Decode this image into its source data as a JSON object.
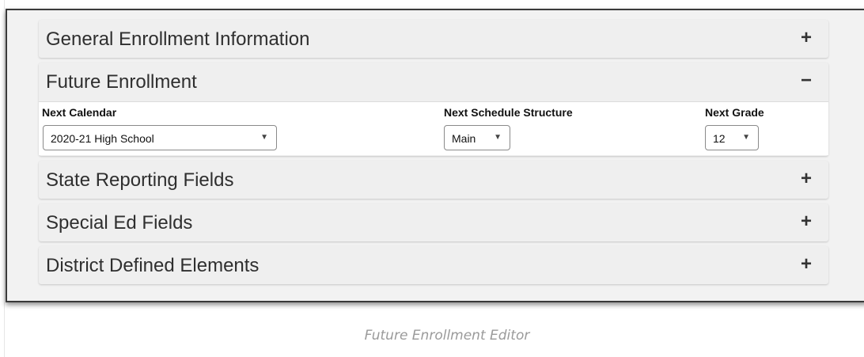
{
  "sections": {
    "general": {
      "title": "General Enrollment Information",
      "toggle": "+"
    },
    "future": {
      "title": "Future Enrollment",
      "toggle": "−",
      "next_calendar": {
        "label": "Next Calendar",
        "value": "2020-21 High School"
      },
      "next_schedule_structure": {
        "label": "Next Schedule Structure",
        "value": "Main"
      },
      "next_grade": {
        "label": "Next Grade",
        "value": "12"
      }
    },
    "state_reporting": {
      "title": "State Reporting Fields",
      "toggle": "+"
    },
    "special_ed": {
      "title": "Special Ed Fields",
      "toggle": "+"
    },
    "district_defined": {
      "title": "District Defined Elements",
      "toggle": "+"
    }
  },
  "dropdown_arrow": "▼",
  "caption": "Future Enrollment Editor",
  "icons": {
    "expand": "plus-icon",
    "collapse": "minus-icon",
    "dropdown": "caret-down-icon"
  }
}
